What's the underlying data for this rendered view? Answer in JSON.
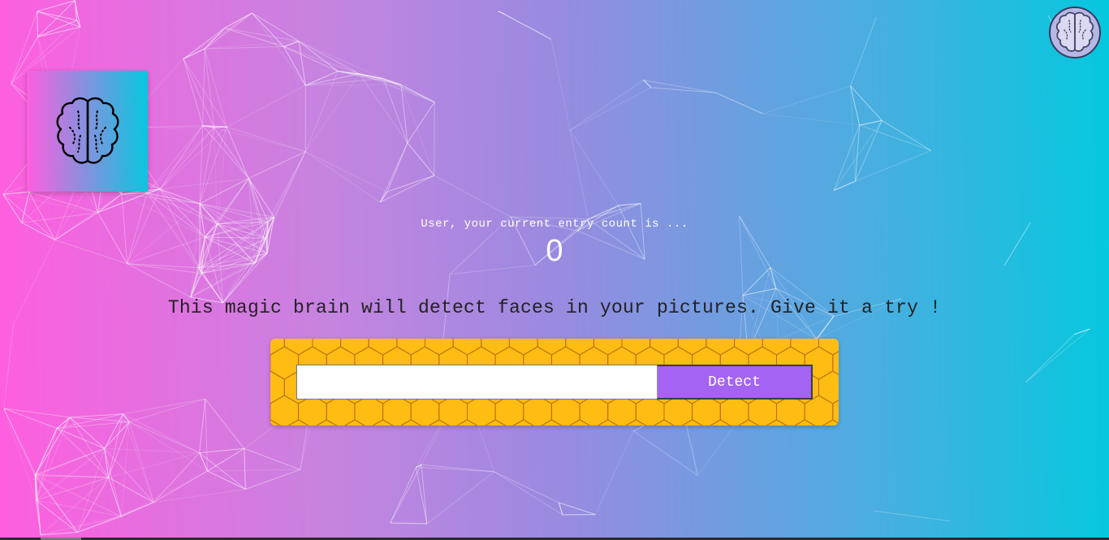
{
  "icons": {
    "logo": "brain-icon",
    "avatar": "brain-icon"
  },
  "colors": {
    "gradient_start": "#ff5edf",
    "gradient_end": "#04c8de",
    "panel": "#ffbc12",
    "button": "#a463f2"
  },
  "rank": {
    "message": "User, your current entry count is ...",
    "count": "0"
  },
  "intro": {
    "text": "This magic brain will detect faces in your pictures. Give it a try !"
  },
  "form": {
    "url_value": "",
    "url_placeholder": "",
    "detect_label": "Detect"
  }
}
